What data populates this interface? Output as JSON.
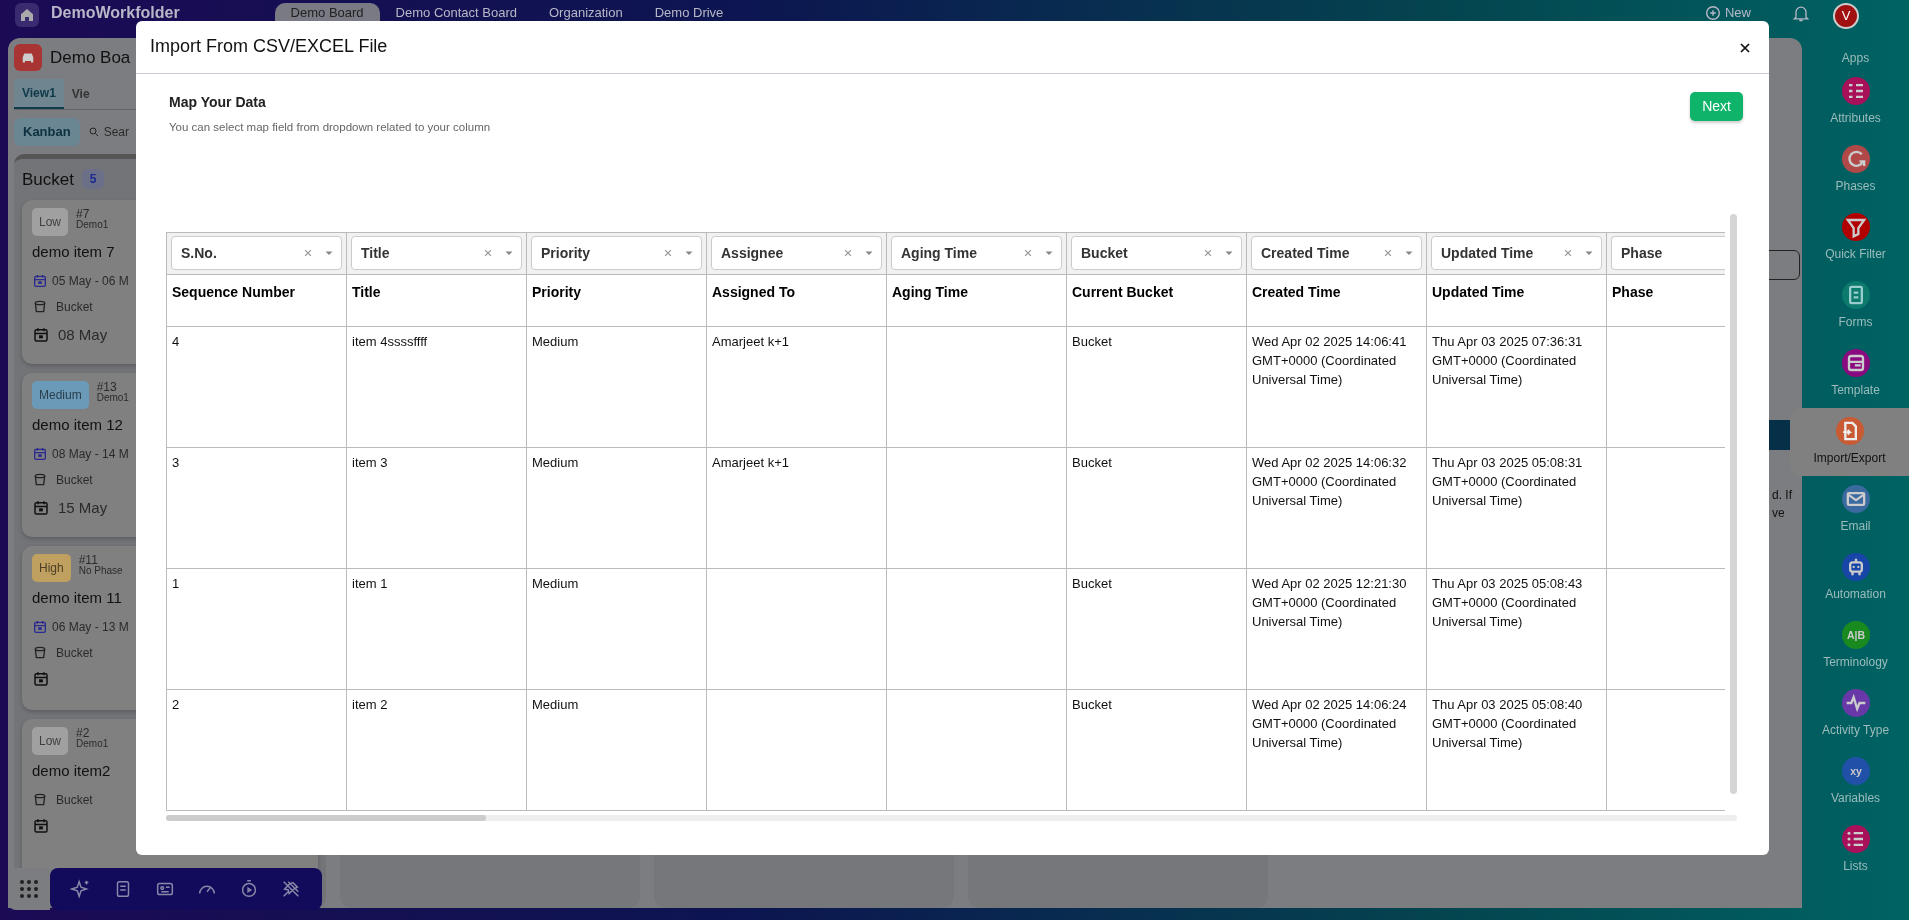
{
  "app_header": {
    "brand": "DemoWorkfolder",
    "tabs": [
      {
        "label": "Demo Board",
        "selected": true
      },
      {
        "label": "Demo Contact Board",
        "selected": false
      },
      {
        "label": "Organization",
        "selected": false
      },
      {
        "label": "Demo Drive",
        "selected": false
      }
    ],
    "new_button": "New",
    "avatar": "V"
  },
  "board": {
    "title": "Demo Boa",
    "views": [
      {
        "label": "View1",
        "selected": true
      },
      {
        "label": "Vie",
        "selected": false
      }
    ],
    "mode_button": "Kanban",
    "search": "Sear",
    "bucket": {
      "name": "Bucket",
      "count": "5",
      "cards": [
        {
          "priority": "Low",
          "color": "#a0a0a0",
          "number": "#7",
          "phase": "Demo1",
          "title": "demo item 7",
          "dates": "05 May - 06 M",
          "bucket": "Bucket",
          "due": "08 May"
        },
        {
          "priority": "Medium",
          "color": "#6a9ab8",
          "number": "#13",
          "phase": "Demo1",
          "title": "demo item 12",
          "dates": "08 May - 14 M",
          "bucket": "Bucket",
          "due": "15 May"
        },
        {
          "priority": "High",
          "color": "#c0a060",
          "number": "#11",
          "phase": "No Phase",
          "title": "demo item 11",
          "dates": "06 May - 13 M",
          "bucket": "Bucket"
        },
        {
          "priority": "Low",
          "color": "#a0a0a0",
          "number": "#2",
          "phase": "Demo1",
          "title": "demo item2",
          "bucket": "Bucket"
        }
      ]
    }
  },
  "side_panel": {
    "text_fragment": "d. If ve"
  },
  "sidebar": {
    "items": [
      {
        "label": "Apps",
        "selected": false
      },
      {
        "label": "Attributes",
        "color": "#a8105a",
        "selected": false
      },
      {
        "label": "Phases",
        "color": "#b04848",
        "selected": false
      },
      {
        "label": "Quick Filter",
        "color": "#b00000",
        "selected": false
      },
      {
        "label": "Forms",
        "color": "#0c7a6c",
        "selected": false
      },
      {
        "label": "Template",
        "color": "#8a0a80",
        "selected": false
      },
      {
        "label": "Import/Export",
        "color": "#c85a34",
        "selected": true
      },
      {
        "label": "Email",
        "color": "#3a6aa0",
        "selected": false
      },
      {
        "label": "Automation",
        "color": "#1845a8",
        "selected": false
      },
      {
        "label": "Terminology",
        "color": "#188a20",
        "glyph": "A|B",
        "selected": false
      },
      {
        "label": "Activity Type",
        "color": "#6838a8",
        "selected": false
      },
      {
        "label": "Variables",
        "color": "#2050a8",
        "glyph": "xy",
        "selected": false
      },
      {
        "label": "Lists",
        "color": "#a8105a",
        "selected": false
      }
    ]
  },
  "modal": {
    "title": "Import From CSV/EXCEL File",
    "heading": "Map Your Data",
    "hint": "You can select map field from dropdown related to your column",
    "next_button": "Next",
    "columns": [
      {
        "mapped": "S.No.",
        "header": "Sequence Number",
        "clearable": true
      },
      {
        "mapped": "Title",
        "header": "Title",
        "clearable": true
      },
      {
        "mapped": "Priority",
        "header": "Priority",
        "clearable": true
      },
      {
        "mapped": "Assignee",
        "header": "Assigned To",
        "clearable": true
      },
      {
        "mapped": "Aging Time",
        "header": "Aging Time",
        "clearable": true
      },
      {
        "mapped": "Bucket",
        "header": "Current Bucket",
        "clearable": true
      },
      {
        "mapped": "Created Time",
        "header": "Created Time",
        "clearable": true
      },
      {
        "mapped": "Updated Time",
        "header": "Updated Time",
        "clearable": true
      },
      {
        "mapped": "Phase",
        "header": "Phase",
        "clearable": false
      }
    ],
    "rows": [
      {
        "cells": [
          "4",
          "item 4ssssffff",
          "Medium",
          "Amarjeet k+1",
          null,
          "Bucket",
          "Wed Apr 02 2025 14:06:41 GMT+0000 (Coordinated Universal Time)",
          "Thu Apr 03 2025 07:36:31 GMT+0000 (Coordinated Universal Time)",
          null
        ]
      },
      {
        "cells": [
          "3",
          "item 3",
          "Medium",
          "Amarjeet k+1",
          null,
          "Bucket",
          "Wed Apr 02 2025 14:06:32 GMT+0000 (Coordinated Universal Time)",
          "Thu Apr 03 2025 05:08:31 GMT+0000 (Coordinated Universal Time)",
          null
        ]
      },
      {
        "cells": [
          "1",
          "item 1",
          "Medium",
          null,
          null,
          "Bucket",
          "Wed Apr 02 2025 12:21:30 GMT+0000 (Coordinated Universal Time)",
          "Thu Apr 03 2025 05:08:43 GMT+0000 (Coordinated Universal Time)",
          null
        ]
      },
      {
        "cells": [
          "2",
          "item 2",
          "Medium",
          null,
          null,
          "Bucket",
          "Wed Apr 02 2025 14:06:24 GMT+0000 (Coordinated Universal Time)",
          "Thu Apr 03 2025 05:08:40 GMT+0000 (Coordinated Universal Time)",
          null
        ]
      }
    ]
  }
}
